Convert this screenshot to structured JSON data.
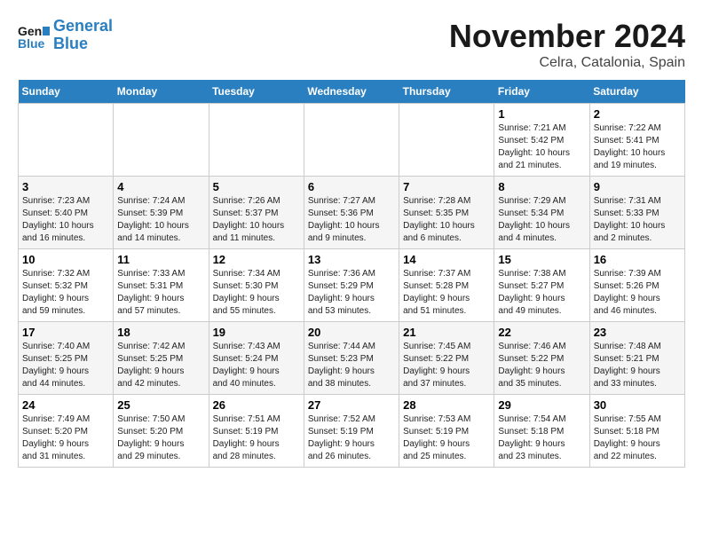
{
  "header": {
    "logo_general": "General",
    "logo_blue": "Blue",
    "month_title": "November 2024",
    "location": "Celra, Catalonia, Spain"
  },
  "days_of_week": [
    "Sunday",
    "Monday",
    "Tuesday",
    "Wednesday",
    "Thursday",
    "Friday",
    "Saturday"
  ],
  "weeks": [
    [
      {
        "day": "",
        "info": ""
      },
      {
        "day": "",
        "info": ""
      },
      {
        "day": "",
        "info": ""
      },
      {
        "day": "",
        "info": ""
      },
      {
        "day": "",
        "info": ""
      },
      {
        "day": "1",
        "info": "Sunrise: 7:21 AM\nSunset: 5:42 PM\nDaylight: 10 hours\nand 21 minutes."
      },
      {
        "day": "2",
        "info": "Sunrise: 7:22 AM\nSunset: 5:41 PM\nDaylight: 10 hours\nand 19 minutes."
      }
    ],
    [
      {
        "day": "3",
        "info": "Sunrise: 7:23 AM\nSunset: 5:40 PM\nDaylight: 10 hours\nand 16 minutes."
      },
      {
        "day": "4",
        "info": "Sunrise: 7:24 AM\nSunset: 5:39 PM\nDaylight: 10 hours\nand 14 minutes."
      },
      {
        "day": "5",
        "info": "Sunrise: 7:26 AM\nSunset: 5:37 PM\nDaylight: 10 hours\nand 11 minutes."
      },
      {
        "day": "6",
        "info": "Sunrise: 7:27 AM\nSunset: 5:36 PM\nDaylight: 10 hours\nand 9 minutes."
      },
      {
        "day": "7",
        "info": "Sunrise: 7:28 AM\nSunset: 5:35 PM\nDaylight: 10 hours\nand 6 minutes."
      },
      {
        "day": "8",
        "info": "Sunrise: 7:29 AM\nSunset: 5:34 PM\nDaylight: 10 hours\nand 4 minutes."
      },
      {
        "day": "9",
        "info": "Sunrise: 7:31 AM\nSunset: 5:33 PM\nDaylight: 10 hours\nand 2 minutes."
      }
    ],
    [
      {
        "day": "10",
        "info": "Sunrise: 7:32 AM\nSunset: 5:32 PM\nDaylight: 9 hours\nand 59 minutes."
      },
      {
        "day": "11",
        "info": "Sunrise: 7:33 AM\nSunset: 5:31 PM\nDaylight: 9 hours\nand 57 minutes."
      },
      {
        "day": "12",
        "info": "Sunrise: 7:34 AM\nSunset: 5:30 PM\nDaylight: 9 hours\nand 55 minutes."
      },
      {
        "day": "13",
        "info": "Sunrise: 7:36 AM\nSunset: 5:29 PM\nDaylight: 9 hours\nand 53 minutes."
      },
      {
        "day": "14",
        "info": "Sunrise: 7:37 AM\nSunset: 5:28 PM\nDaylight: 9 hours\nand 51 minutes."
      },
      {
        "day": "15",
        "info": "Sunrise: 7:38 AM\nSunset: 5:27 PM\nDaylight: 9 hours\nand 49 minutes."
      },
      {
        "day": "16",
        "info": "Sunrise: 7:39 AM\nSunset: 5:26 PM\nDaylight: 9 hours\nand 46 minutes."
      }
    ],
    [
      {
        "day": "17",
        "info": "Sunrise: 7:40 AM\nSunset: 5:25 PM\nDaylight: 9 hours\nand 44 minutes."
      },
      {
        "day": "18",
        "info": "Sunrise: 7:42 AM\nSunset: 5:25 PM\nDaylight: 9 hours\nand 42 minutes."
      },
      {
        "day": "19",
        "info": "Sunrise: 7:43 AM\nSunset: 5:24 PM\nDaylight: 9 hours\nand 40 minutes."
      },
      {
        "day": "20",
        "info": "Sunrise: 7:44 AM\nSunset: 5:23 PM\nDaylight: 9 hours\nand 38 minutes."
      },
      {
        "day": "21",
        "info": "Sunrise: 7:45 AM\nSunset: 5:22 PM\nDaylight: 9 hours\nand 37 minutes."
      },
      {
        "day": "22",
        "info": "Sunrise: 7:46 AM\nSunset: 5:22 PM\nDaylight: 9 hours\nand 35 minutes."
      },
      {
        "day": "23",
        "info": "Sunrise: 7:48 AM\nSunset: 5:21 PM\nDaylight: 9 hours\nand 33 minutes."
      }
    ],
    [
      {
        "day": "24",
        "info": "Sunrise: 7:49 AM\nSunset: 5:20 PM\nDaylight: 9 hours\nand 31 minutes."
      },
      {
        "day": "25",
        "info": "Sunrise: 7:50 AM\nSunset: 5:20 PM\nDaylight: 9 hours\nand 29 minutes."
      },
      {
        "day": "26",
        "info": "Sunrise: 7:51 AM\nSunset: 5:19 PM\nDaylight: 9 hours\nand 28 minutes."
      },
      {
        "day": "27",
        "info": "Sunrise: 7:52 AM\nSunset: 5:19 PM\nDaylight: 9 hours\nand 26 minutes."
      },
      {
        "day": "28",
        "info": "Sunrise: 7:53 AM\nSunset: 5:19 PM\nDaylight: 9 hours\nand 25 minutes."
      },
      {
        "day": "29",
        "info": "Sunrise: 7:54 AM\nSunset: 5:18 PM\nDaylight: 9 hours\nand 23 minutes."
      },
      {
        "day": "30",
        "info": "Sunrise: 7:55 AM\nSunset: 5:18 PM\nDaylight: 9 hours\nand 22 minutes."
      }
    ]
  ]
}
